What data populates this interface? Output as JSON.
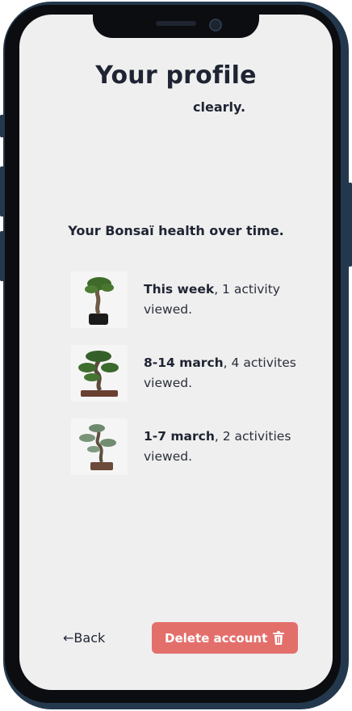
{
  "page": {
    "title": "Your profile",
    "subtitle": "clearly.",
    "section_heading": "Your Bonsaï health over time."
  },
  "history": [
    {
      "period": "This week",
      "detail": ", 1 activity viewed.",
      "image": "bonsai-plant-image"
    },
    {
      "period": "8-14 march",
      "detail": ", 4 activites viewed.",
      "image": "bonsai-tree-image"
    },
    {
      "period": "1-7 march",
      "detail": ", 2 activities viewed.",
      "image": "bonsai-pine-image"
    }
  ],
  "footer": {
    "back_label": "Back",
    "back_icon": "arrow-left-icon",
    "delete_label": "Delete account",
    "delete_icon": "trash-icon"
  },
  "colors": {
    "screen_background": "#efefef",
    "text": "#1f2433",
    "danger": "#e36f6b",
    "phone_frame": "#24384d"
  }
}
